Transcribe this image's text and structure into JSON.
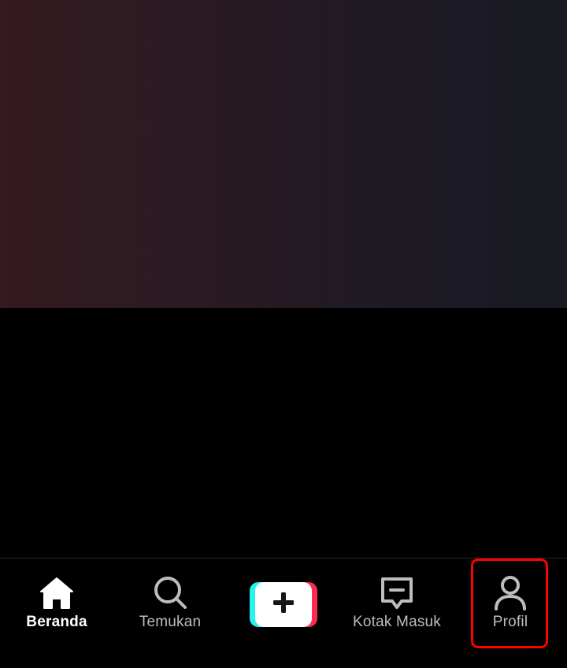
{
  "tab_bar": {
    "tabs": [
      {
        "id": "home",
        "label": "Beranda",
        "icon": "home-icon",
        "active": true
      },
      {
        "id": "discover",
        "label": "Temukan",
        "icon": "search-icon",
        "active": false
      },
      {
        "id": "create",
        "label": "",
        "icon": "plus-icon",
        "active": false
      },
      {
        "id": "inbox",
        "label": "Kotak Masuk",
        "icon": "inbox-icon",
        "active": false
      },
      {
        "id": "profile",
        "label": "Profil",
        "icon": "person-icon",
        "active": false
      }
    ]
  },
  "colors": {
    "background": "#000000",
    "active_label": "#ffffff",
    "inactive_label": "#bdbdbd",
    "create_cyan": "#25f4ee",
    "create_pink": "#fe2c55",
    "highlight": "#ff0000"
  }
}
